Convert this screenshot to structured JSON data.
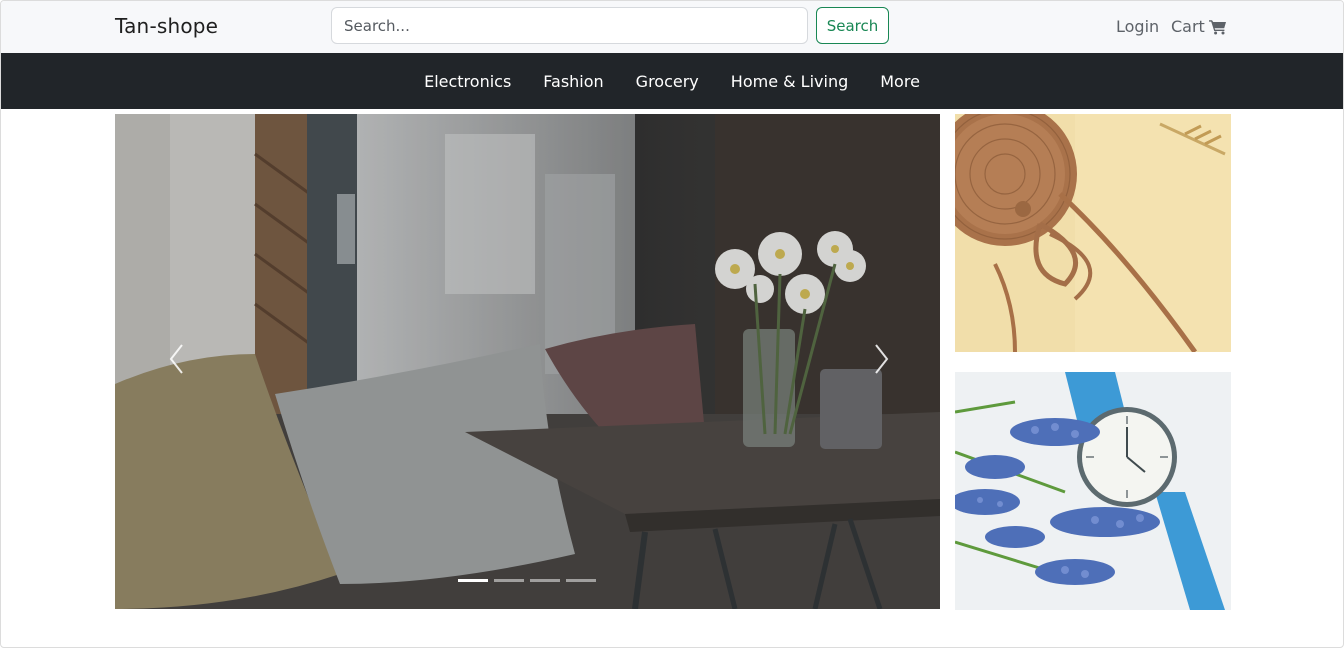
{
  "header": {
    "brand": "Tan-shope",
    "search": {
      "placeholder": "Search...",
      "value": ""
    },
    "search_button_label": "Search",
    "login_label": "Login",
    "cart_label": "Cart",
    "cart_icon": "cart-icon",
    "background": "#f7f8fa"
  },
  "categories": {
    "items": [
      "Electronics",
      "Fashion",
      "Grocery",
      "Home & Living",
      "More"
    ],
    "background": "#212529"
  },
  "carousel": {
    "image": "cafe-table-pillows-flowers",
    "prev_icon": "chevron-left-icon",
    "next_icon": "chevron-right-icon",
    "slide_count": 4,
    "active_slide": 1
  },
  "side_images": {
    "top": "rattan-bag",
    "bottom": "wristwatch-flowers"
  },
  "colors": {
    "accent_green": "#198754",
    "nav_dark": "#212529"
  }
}
